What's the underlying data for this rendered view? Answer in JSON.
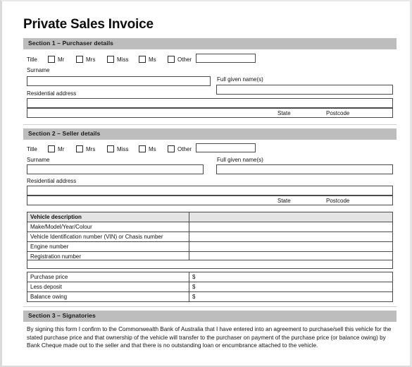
{
  "document": {
    "title": "Private Sales Invoice"
  },
  "sections": {
    "purchaser": {
      "bar_label": "Section 1 – Purchaser details",
      "title_label": "Title",
      "title_options": [
        "Mr",
        "Mrs",
        "Miss",
        "Ms",
        "Other"
      ],
      "other_value": "",
      "surname_label": "Surname",
      "surname_value": "",
      "given_label": "Full given name(s)",
      "given_value": "",
      "address_label": "Residential address",
      "address_value": "",
      "address_line2_value": "",
      "state_label": "State",
      "postcode_label": "Postcode"
    },
    "seller": {
      "bar_label": "Section 2 – Seller details",
      "title_label": "Title",
      "title_options": [
        "Mr",
        "Mrs",
        "Miss",
        "Ms",
        "Other"
      ],
      "other_value": "",
      "surname_label": "Surname",
      "surname_value": "",
      "given_label": "Full given name(s)",
      "given_value": "",
      "address_label": "Residential address",
      "address_value": "",
      "address_line2_value": "",
      "state_label": "State",
      "postcode_label": "Postcode"
    },
    "signatories": {
      "bar_label": "Section 3 – Signatories",
      "declaration": "By signing this form I confirm to the Commonwealth Bank of Australia that I have entered into an agreement to purchase/sell this vehicle for the stated purchase price and that ownership of the vehicle will transfer to the purchaser on payment of the purchase price (or balance owing) by Bank Cheque made out to the seller and that there is no outstanding loan or encumbrance attached to the vehicle."
    }
  },
  "vehicle_table": {
    "header_label": "Vehicle description",
    "header_value": "",
    "rows": [
      {
        "label": "Make/Model/Year/Colour",
        "value": ""
      },
      {
        "label": "Vehicle Identification number (VIN) or Chasis number",
        "value": ""
      },
      {
        "label": "Engine number",
        "value": ""
      },
      {
        "label": "Registration number",
        "value": ""
      }
    ],
    "price_rows": [
      {
        "label": "Purchase price",
        "value": "$"
      },
      {
        "label": "Less deposit",
        "value": "$"
      },
      {
        "label": "Balance owing",
        "value": "$"
      }
    ]
  },
  "colors": {
    "section_bar": "#bdbdbd",
    "table_header": "#e4e4e4",
    "border": "#4a4a4a",
    "text": "#111111"
  }
}
